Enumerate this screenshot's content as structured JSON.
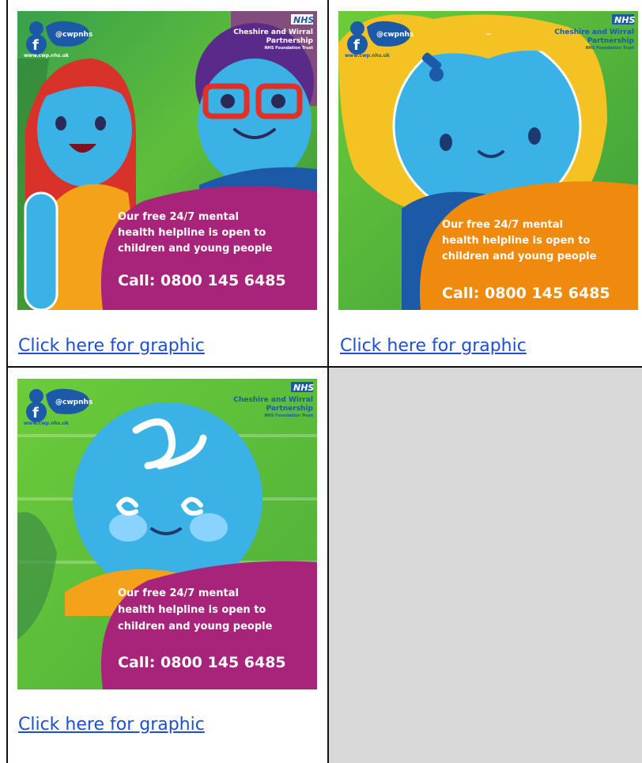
{
  "cells": [
    {
      "handle": "@cwpnhs",
      "web": "www.cwp.nhs.uk",
      "org_badge": "NHS",
      "org_name_1": "Cheshire and Wirral",
      "org_name_2": "Partnership",
      "org_sub": "NHS Foundation Trust",
      "line1": "Our free 24/7 mental",
      "line2": "health helpline is open to",
      "line3": "children and young people",
      "call": "Call: 0800 145 6485",
      "link": "Click here for graphic",
      "accent": "#a8247a"
    },
    {
      "handle": "@cwpnhs",
      "web": "www.cwp.nhs.uk",
      "org_badge": "NHS",
      "org_name_1": "Cheshire and Wirral",
      "org_name_2": "Partnership",
      "org_sub": "NHS Foundation Trust",
      "line1": "Our free 24/7 mental",
      "line2": "health helpline is open to",
      "line3": "children and young people",
      "call": "Call: 0800 145 6485",
      "link": "Click here for graphic",
      "accent": "#ef8a0f"
    },
    {
      "handle": "@cwpnhs",
      "web": "www.cwp.nhs.uk",
      "org_badge": "NHS",
      "org_name_1": "Cheshire and Wirral",
      "org_name_2": "Partnership",
      "org_sub": "NHS Foundation Trust",
      "line1": "Our free 24/7 mental",
      "line2": "health helpline is open to",
      "line3": "children and young people",
      "call": "Call: 0800 145 6485",
      "link": "Click here for graphic",
      "accent": "#a8247a"
    }
  ]
}
